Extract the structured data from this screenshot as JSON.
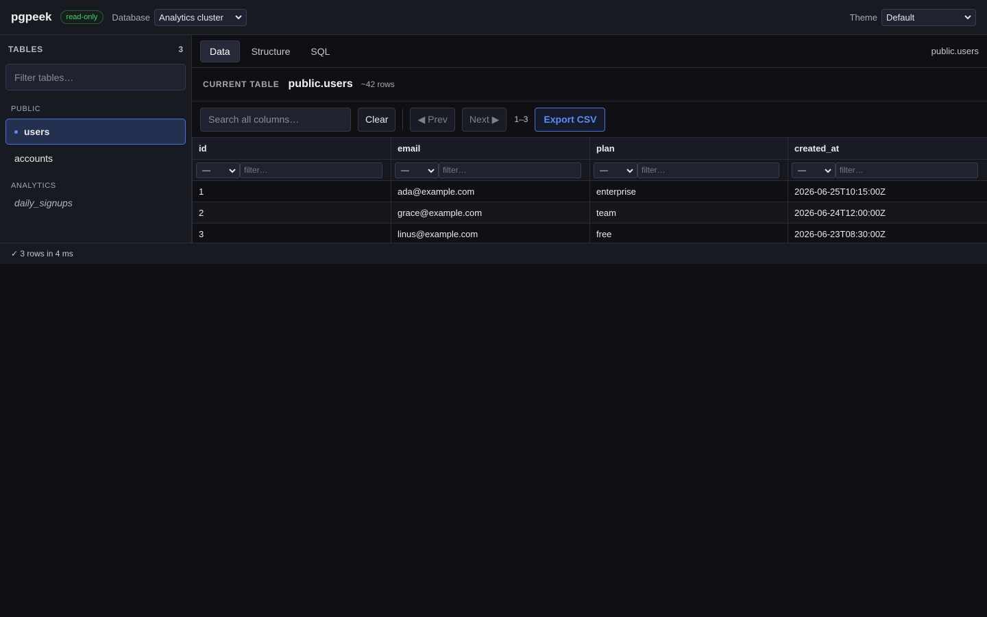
{
  "app": {
    "name": "pgpeek",
    "mode_badge": "read-only"
  },
  "header": {
    "database_label": "Database",
    "database_selected": "Analytics cluster",
    "theme_label": "Theme",
    "theme_selected": "Default"
  },
  "sidebar": {
    "title": "TABLES",
    "count": "3",
    "filter_placeholder": "Filter tables…",
    "groups": [
      {
        "label": "PUBLIC",
        "items": [
          {
            "label": "users",
            "active": true
          },
          {
            "label": "accounts"
          }
        ]
      },
      {
        "label": "ANALYTICS",
        "items": [
          {
            "label": "daily_signups",
            "view": true
          }
        ]
      }
    ]
  },
  "tabs": {
    "items": [
      {
        "label": "Data",
        "active": true
      },
      {
        "label": "Structure"
      },
      {
        "label": "SQL"
      }
    ],
    "path": "public.users"
  },
  "current_table": {
    "label": "CURRENT TABLE",
    "name": "public.users",
    "rows": "~42 rows"
  },
  "toolbar": {
    "search_placeholder": "Search all columns…",
    "clear": "Clear",
    "prev": "◀ Prev",
    "next": "Next ▶",
    "page_range": "1–3",
    "export": "Export CSV"
  },
  "table": {
    "columns": [
      "id",
      "email",
      "plan",
      "created_at"
    ],
    "filter_op": "—",
    "filter_placeholder": "filter…",
    "rows": [
      [
        "1",
        "ada@example.com",
        "enterprise",
        "2026-06-25T10:15:00Z"
      ],
      [
        "2",
        "grace@example.com",
        "team",
        "2026-06-24T12:00:00Z"
      ],
      [
        "3",
        "linus@example.com",
        "free",
        "2026-06-23T08:30:00Z"
      ]
    ]
  },
  "status": {
    "text": "✓ 3 rows in 4 ms"
  },
  "colors": {
    "accent": "#5c8df5",
    "success": "#4ec97a",
    "background": "#101014",
    "panel": "#181a22"
  }
}
